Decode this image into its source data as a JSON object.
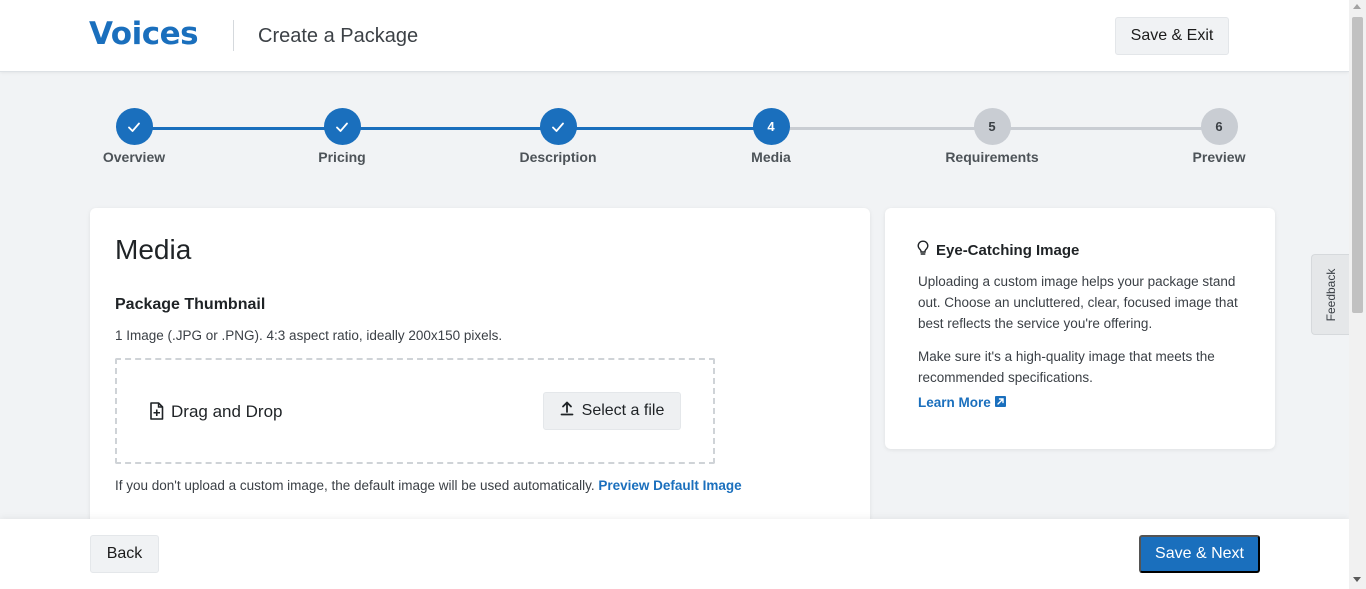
{
  "header": {
    "logo": "Voices",
    "title": "Create a Package",
    "save_exit_label": "Save & Exit"
  },
  "stepper": {
    "steps": [
      {
        "number": "1",
        "label": "Overview",
        "status": "completed",
        "icon": "check-icon"
      },
      {
        "number": "2",
        "label": "Pricing",
        "status": "completed",
        "icon": "check-icon"
      },
      {
        "number": "3",
        "label": "Description",
        "status": "completed",
        "icon": "check-icon"
      },
      {
        "number": "4",
        "label": "Media",
        "status": "active"
      },
      {
        "number": "5",
        "label": "Requirements",
        "status": "upcoming"
      },
      {
        "number": "6",
        "label": "Preview",
        "status": "upcoming"
      }
    ]
  },
  "media": {
    "title": "Media",
    "thumbnail_title": "Package Thumbnail",
    "thumbnail_desc": "1 Image (.JPG or .PNG). 4:3 aspect ratio, ideally 200x150 pixels.",
    "dropzone_label": "Drag and Drop",
    "dropzone_icon": "file-plus-icon",
    "select_file_label": "Select a file",
    "select_file_icon": "upload-icon",
    "default_note": "If you don't upload a custom image, the default image will be used automatically.",
    "preview_default_link": "Preview Default Image"
  },
  "tip": {
    "icon": "lightbulb-icon",
    "title": "Eye-Catching Image",
    "paragraph1": "Uploading a custom image helps your package stand out. Choose an uncluttered, clear, focused image that best reflects the service you're offering.",
    "paragraph2": "Make sure it's a high-quality image that meets the recommended specifications.",
    "learn_more": "Learn More",
    "learn_more_icon": "external-link-icon"
  },
  "feedback_tab": "Feedback",
  "footer": {
    "back_label": "Back",
    "next_label": "Save & Next"
  },
  "colors": {
    "brand_blue": "#1a6fbd",
    "inactive_step": "#c9cdd3",
    "page_bg": "#f1f3f5"
  }
}
